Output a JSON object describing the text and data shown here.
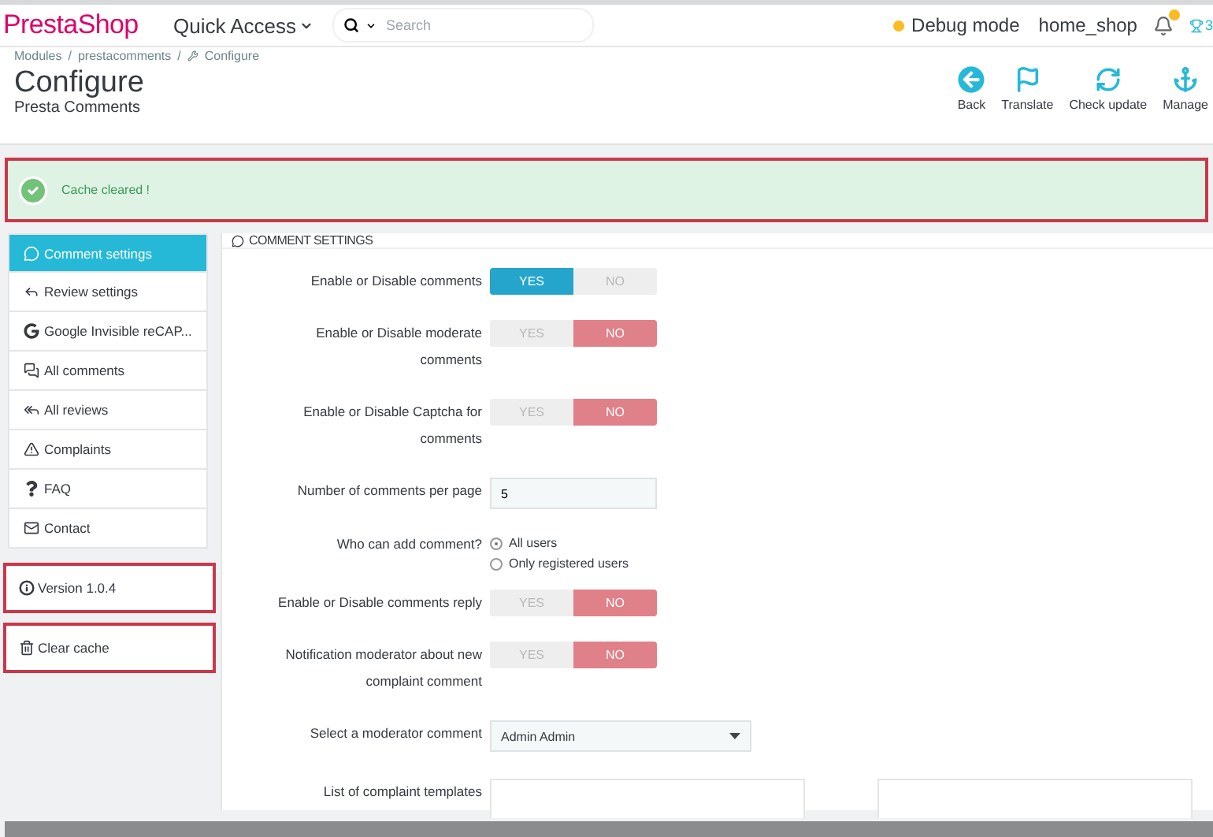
{
  "topbar": {
    "logo": "PrestaShop",
    "quick_access": "Quick Access",
    "search": {
      "placeholder": "Search"
    },
    "debug": "Debug mode",
    "shop": "home_shop",
    "notification_badge": true,
    "trophy_count": "3"
  },
  "breadcrumb": {
    "separator": "/",
    "items": [
      "Modules",
      "prestacomments",
      "Configure"
    ]
  },
  "header": {
    "title": "Configure",
    "subtitle": "Presta Comments",
    "actions": [
      "Back",
      "Translate",
      "Check update",
      "Manage"
    ]
  },
  "alert": {
    "text": "Cache cleared !",
    "highlighted": true
  },
  "sidebar": {
    "items": [
      {
        "label": "Comment settings",
        "selected": true
      },
      {
        "label": "Review settings",
        "selected": false
      },
      {
        "label": "Google Invisible reCAP...",
        "selected": false
      },
      {
        "label": "All comments",
        "selected": false
      },
      {
        "label": "All reviews",
        "selected": false
      },
      {
        "label": "Complaints",
        "selected": false
      },
      {
        "label": "FAQ",
        "selected": false
      },
      {
        "label": "Contact",
        "selected": false
      }
    ],
    "extras": [
      {
        "label": "Version 1.0.4",
        "highlighted": true
      },
      {
        "label": "Clear cache",
        "highlighted": true
      }
    ]
  },
  "panel": {
    "title": "COMMENT SETTINGS",
    "fields": [
      {
        "kind": "toggle",
        "label": "Enable or Disable comments",
        "yes": "YES",
        "no": "NO",
        "on": true
      },
      {
        "kind": "toggle",
        "label": "Enable or Disable moderate comments",
        "yes": "YES",
        "no": "NO",
        "on": false
      },
      {
        "kind": "toggle",
        "label": "Enable or Disable Captcha for comments",
        "yes": "YES",
        "no": "NO",
        "on": false
      },
      {
        "kind": "number",
        "label": "Number of comments per page",
        "value": "5"
      },
      {
        "kind": "radio",
        "label": "Who can add comment?",
        "options": [
          {
            "label": "All users",
            "selected": true
          },
          {
            "label": "Only registered users",
            "selected": false
          }
        ]
      },
      {
        "kind": "toggle",
        "label": "Enable or Disable comments reply",
        "yes": "YES",
        "no": "NO",
        "on": false
      },
      {
        "kind": "toggle",
        "label": "Notification moderator about new complaint comment",
        "yes": "YES",
        "no": "NO",
        "on": false
      },
      {
        "kind": "select",
        "label": "Select a moderator comment",
        "value": "Admin Admin"
      },
      {
        "kind": "templates",
        "label": "List of complaint templates"
      }
    ]
  }
}
